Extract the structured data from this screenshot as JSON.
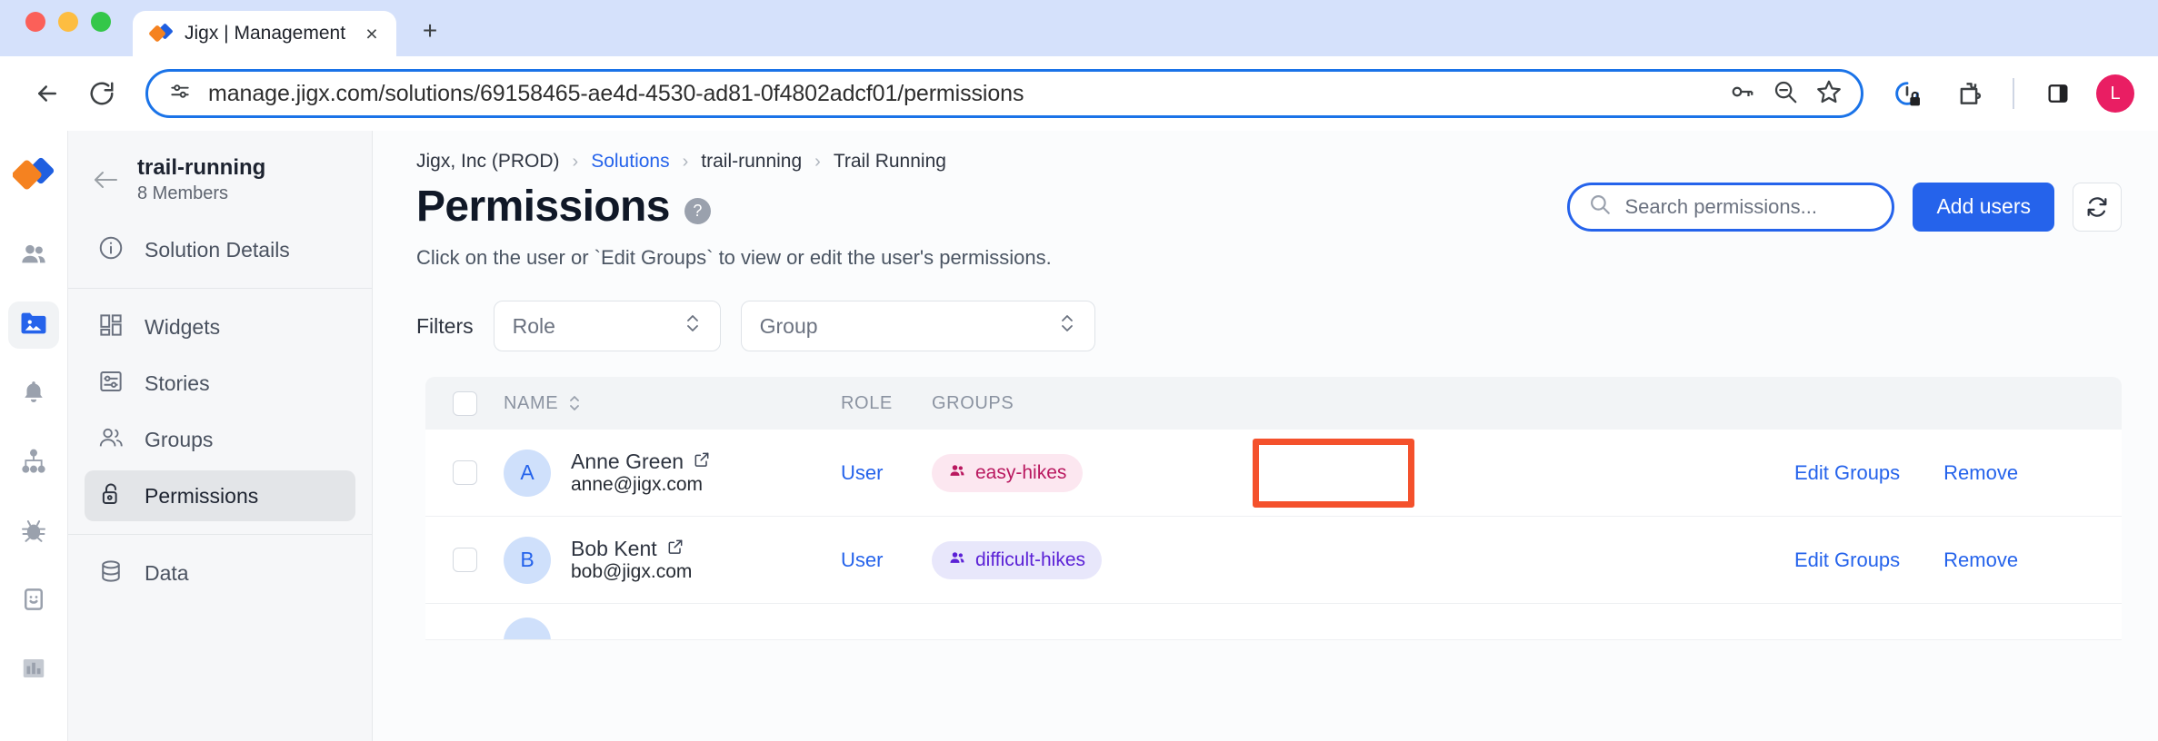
{
  "browser": {
    "tab": {
      "title": "Jigx | Management",
      "close_label": "×",
      "favicon": "jigx-logo-icon"
    },
    "new_tab_label": "+",
    "url": "manage.jigx.com/solutions/69158465-ae4d-4530-ad81-0f4802adcf01/permissions",
    "nav": {
      "back": "back-arrow-icon",
      "forward": "forward-arrow-icon",
      "reload": "reload-icon"
    },
    "omnibox_icons": [
      "site-settings-icon",
      "password-key-icon",
      "zoom-out-icon",
      "bookmark-star-icon"
    ],
    "toolbar_icons": [
      "privacy-lock-icon",
      "extensions-puzzle-icon",
      "side-panel-icon"
    ],
    "profile_initial": "L"
  },
  "rail": {
    "logo": "jigx-logo-icon",
    "items": [
      {
        "name": "users",
        "icon": "people-icon",
        "active": false
      },
      {
        "name": "solutions",
        "icon": "image-folder-icon",
        "active": true
      },
      {
        "name": "notifications",
        "icon": "bell-icon",
        "active": false
      },
      {
        "name": "hierarchy",
        "icon": "org-chart-icon",
        "active": false
      },
      {
        "name": "debug",
        "icon": "bug-icon",
        "active": false
      },
      {
        "name": "device",
        "icon": "device-smile-icon",
        "active": false
      },
      {
        "name": "analytics",
        "icon": "bar-chart-icon",
        "active": false
      }
    ]
  },
  "sidebar": {
    "back_icon": "back-arrow-icon",
    "title": "trail-running",
    "subtitle": "8 Members",
    "group1": [
      {
        "label": "Solution Details",
        "icon": "info-circle-icon",
        "active": false
      }
    ],
    "group2": [
      {
        "label": "Widgets",
        "icon": "widgets-grid-icon",
        "active": false
      },
      {
        "label": "Stories",
        "icon": "stories-sliders-icon",
        "active": false
      },
      {
        "label": "Groups",
        "icon": "groups-people-icon",
        "active": false
      },
      {
        "label": "Permissions",
        "icon": "lock-icon",
        "active": true
      }
    ],
    "group3": [
      {
        "label": "Data",
        "icon": "database-icon",
        "active": false
      }
    ]
  },
  "breadcrumb": [
    {
      "label": "Jigx, Inc (PROD)",
      "link": false
    },
    {
      "label": "Solutions",
      "link": true
    },
    {
      "label": "trail-running",
      "link": false
    },
    {
      "label": "Trail Running",
      "link": false
    }
  ],
  "breadcrumb_separator": "›",
  "header": {
    "title": "Permissions",
    "help_icon": "help-question-icon",
    "help_glyph": "?",
    "subtitle": "Click on the user or `Edit Groups` to view or edit the user's permissions."
  },
  "search": {
    "placeholder": "Search permissions...",
    "value": "",
    "icon": "search-icon"
  },
  "actions": {
    "add_users_label": "Add users",
    "refresh_icon": "refresh-icon"
  },
  "filters": {
    "label": "Filters",
    "role": {
      "value": "Role",
      "icon": "chevron-updown-icon"
    },
    "group": {
      "value": "Group",
      "icon": "chevron-updown-icon"
    }
  },
  "table": {
    "columns": [
      "NAME",
      "ROLE",
      "GROUPS"
    ],
    "name_sort_icon": "sort-updown-icon",
    "rows": [
      {
        "initial": "A",
        "name": "Anne Green",
        "external_link_icon": "external-link-icon",
        "email": "anne@jigx.com",
        "role": "User",
        "groups": [
          {
            "label": "easy-hikes",
            "style": "pink",
            "icon": "group-people-icon"
          }
        ],
        "edit_label": "Edit Groups",
        "remove_label": "Remove",
        "highlighted": true
      },
      {
        "initial": "B",
        "name": "Bob Kent",
        "external_link_icon": "external-link-icon",
        "email": "bob@jigx.com",
        "role": "User",
        "groups": [
          {
            "label": "difficult-hikes",
            "style": "purple",
            "icon": "group-people-icon"
          }
        ],
        "edit_label": "Edit Groups",
        "remove_label": "Remove",
        "highlighted": false
      }
    ]
  },
  "colors": {
    "accent_blue": "#2563eb",
    "highlight_orange": "#f4512c",
    "chip_pink_bg": "#fce7f0",
    "chip_pink_fg": "#b9185f",
    "chip_purple_bg": "#e8e7fb",
    "chip_purple_fg": "#5b21d6",
    "profile_pink": "#e91e63"
  }
}
